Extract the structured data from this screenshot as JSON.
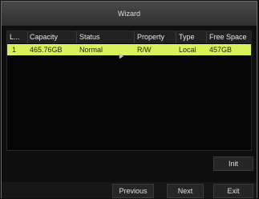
{
  "window": {
    "title": "Wizard"
  },
  "table": {
    "headers": [
      "L...",
      "Capacity",
      "Status",
      "Property",
      "Type",
      "Free Space"
    ],
    "rows": [
      [
        "1",
        "465.76GB",
        "Normal",
        "R/W",
        "Local",
        "457GB"
      ]
    ]
  },
  "buttons": {
    "init": "Init",
    "previous": "Previous",
    "next": "Next",
    "exit": "Exit"
  },
  "colors": {
    "selected_row": "#d8f25a",
    "background": "#0f0f0f"
  },
  "icons": [
    "mouse-cursor-icon"
  ]
}
